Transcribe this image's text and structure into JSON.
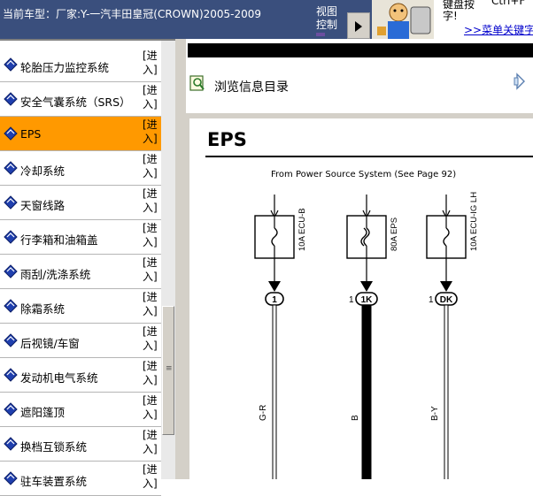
{
  "header": {
    "car_model_label": "当前车型：厂家:Y-一汽丰田皇冠(CROWN)2005-2009",
    "view_control": "视图控制",
    "tip_line1": "键盘按",
    "tip_line2": "字!",
    "tip_shortcut": "Ctrl+F",
    "tip_link": ">>菜单关键字"
  },
  "sidebar": {
    "enter_label": "[进入]",
    "items": [
      {
        "label": "轮胎压力监控系统"
      },
      {
        "label": "安全气囊系统（SRS）"
      },
      {
        "label": "EPS"
      },
      {
        "label": "冷却系统"
      },
      {
        "label": "天窗线路"
      },
      {
        "label": "行李箱和油箱盖"
      },
      {
        "label": "雨刮/洗涤系统"
      },
      {
        "label": "除霜系统"
      },
      {
        "label": "后视镜/车窗"
      },
      {
        "label": "发动机电气系统"
      },
      {
        "label": "遮阳篷顶"
      },
      {
        "label": "换档互锁系统"
      },
      {
        "label": "驻车装置系统"
      }
    ],
    "selected_index": 2,
    "selected_color": "#ff9900"
  },
  "content": {
    "browse_label": "浏览信息目录",
    "diagram": {
      "title": "EPS",
      "source_text": "From Power Source System (See Page 92)",
      "fuses": [
        {
          "name": "10A ECU-B",
          "connector_pin": "1",
          "connector_id": "",
          "wire_color": "G-R"
        },
        {
          "name": "80A EPS",
          "connector_pin": "1",
          "connector_id": "1K",
          "wire_color": "B"
        },
        {
          "name": "10A ECU-IG LH",
          "connector_pin": "1",
          "connector_id": "DK",
          "wire_color": "B-Y"
        }
      ]
    }
  },
  "icons": {
    "book": "book-icon",
    "browse": "browse-catalog-icon",
    "nav": "next-page-arrow-icon",
    "mascot": "mascot-icon"
  }
}
